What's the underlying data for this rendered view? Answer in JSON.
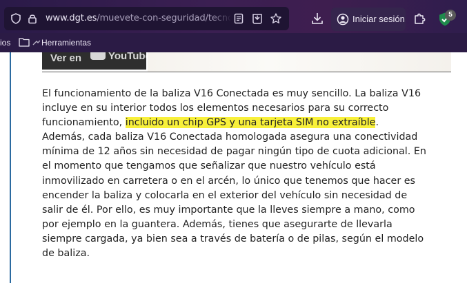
{
  "browser": {
    "url_domain": "www.dgt.es",
    "url_path": "/muevete-con-seguridad/tecno",
    "login_label": "Iniciar sesión",
    "shield_count": "5"
  },
  "bookmarks": {
    "items": [
      {
        "label": "ios"
      },
      {
        "label": "Herramientas"
      }
    ]
  },
  "video": {
    "label": "Ver en",
    "brand": "YouTube"
  },
  "article": {
    "lines": [
      "El funcionamiento de la baliza V16 Conectada es muy sencillo. La baliza V16",
      "incluye en su interior todos los elementos necesarios para su correcto",
      {
        "before": "funcionamiento, ",
        "highlight": "incluido un chip GPS y una tarjeta SIM no extraíble",
        "after": "."
      },
      "Además, cada baliza V16 Conectada homologada asegura una conectividad",
      "mínima de 12 años sin necesidad de pagar ningún tipo de cuota adicional. En",
      "el momento que tengamos que señalizar que nuestro vehículo está",
      "inmovilizado en carretera o en el arcén, lo único que tenemos que hacer es",
      "encender la baliza y colocarla en el exterior del vehículo sin necesidad de",
      "salir de él. Por ello, es muy importante que la lleves siempre a mano, como",
      "por ejemplo en la guantera. Además, tienes que asegurarte de llevarla",
      "siempre cargada, ya bien sea a través de batería o de pilas, según el modelo",
      "de baliza."
    ]
  },
  "colors": {
    "highlight": "#f8f03a",
    "toolbar": "#3b1f52",
    "text": "#222222"
  }
}
